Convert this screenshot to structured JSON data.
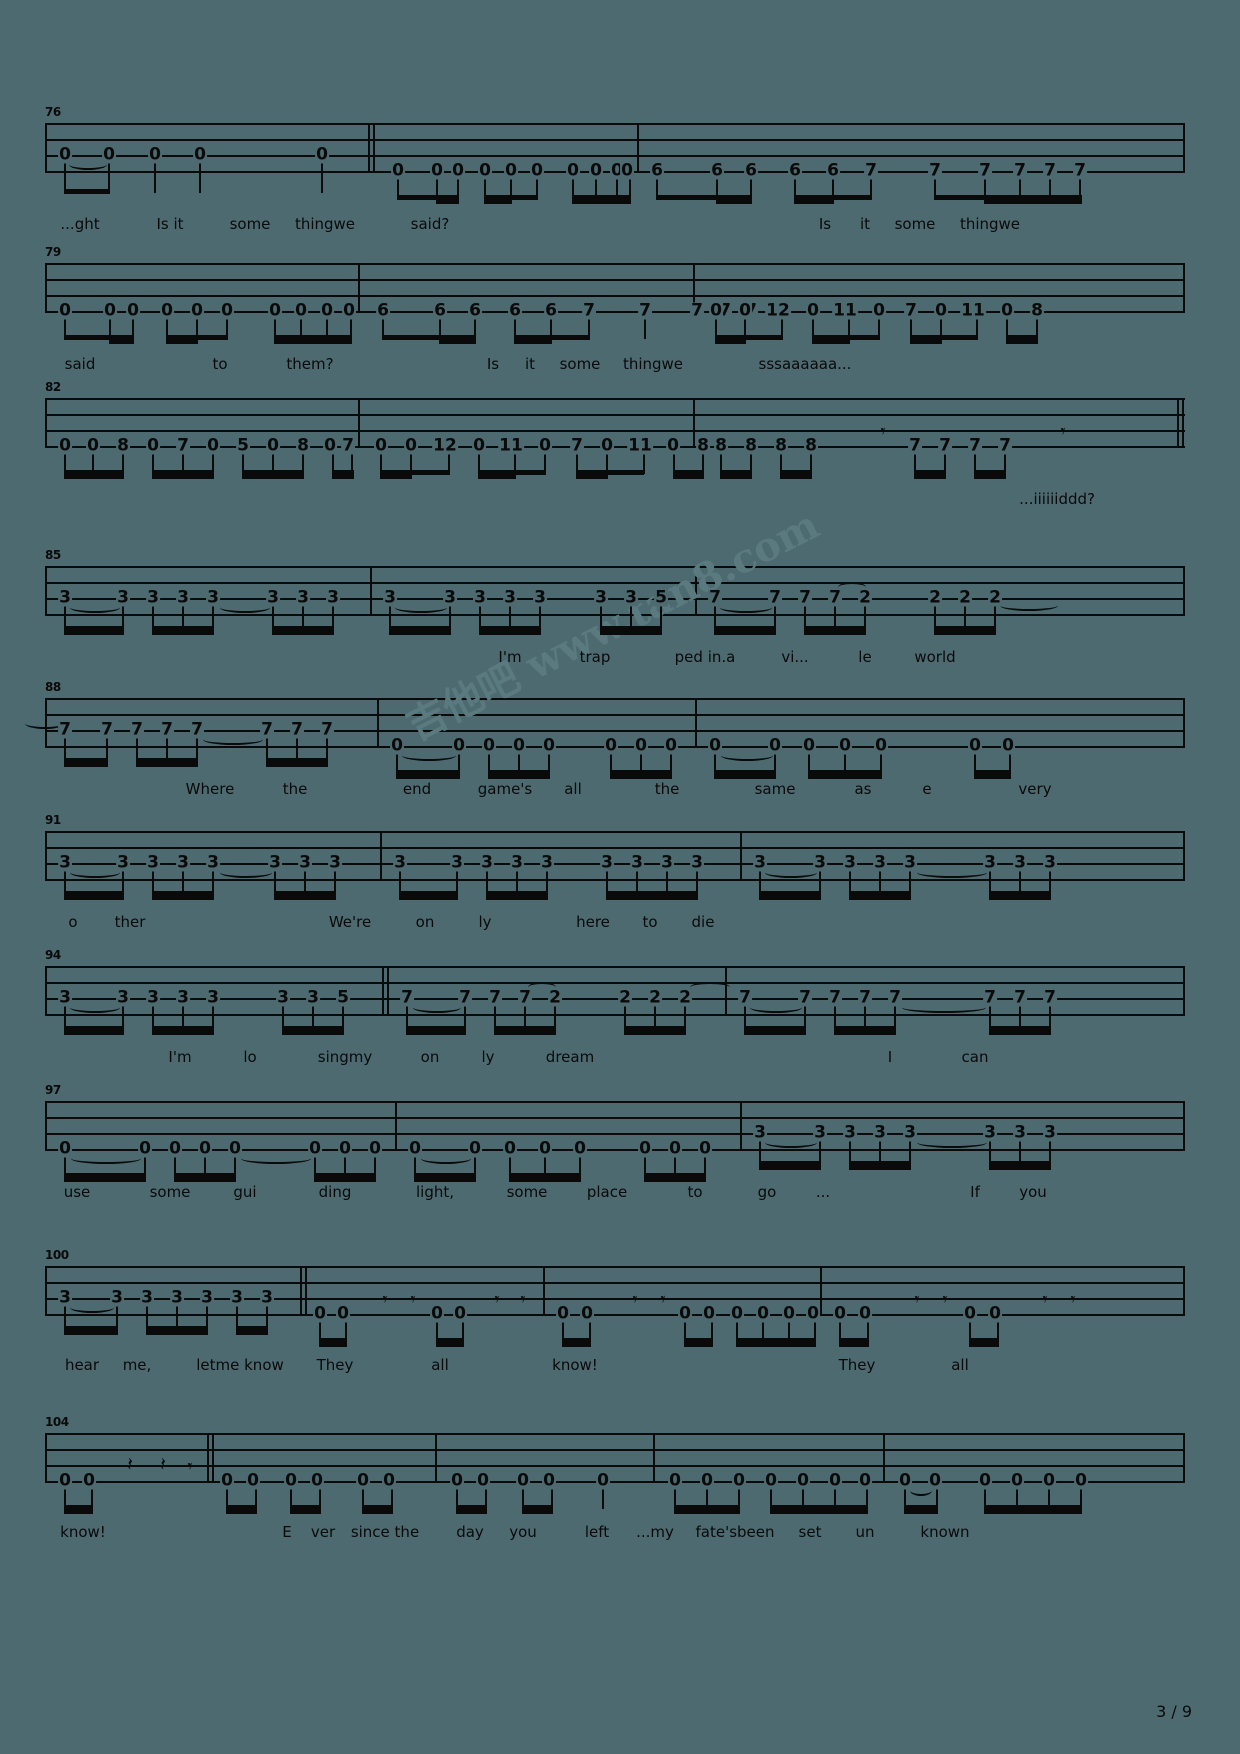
{
  "document": {
    "type": "guitar-bass-tablature",
    "page_label": "3 / 9",
    "watermark": "吉他吧 www.tan8.com",
    "staff_lines": 4,
    "background_color": "#4d6a70",
    "ink_color": "#0a0a0a"
  },
  "systems": [
    {
      "measure_number": "76",
      "notes": "0 0 0 0 0 | 0 0 0 0 0 0 0 0 0 0 | 6 6 6 6 6 7 7 7 7 7 7",
      "lyrics": [
        "...ght",
        "Is  it",
        "some",
        "thingwe",
        "said?",
        "Is",
        "it",
        "some",
        "thingwe"
      ]
    },
    {
      "measure_number": "79",
      "notes": "0 0 0 0 0 0 0 0 0 0 | 6 6 6 6 6 7 7 7 7 7 7 | 0 0 12 0 11 0 7 0 11 0 8",
      "lyrics": [
        "said",
        "to",
        "them?",
        "Is",
        "it",
        "some",
        "thingwe",
        "sssaaaaaa..."
      ]
    },
    {
      "measure_number": "82",
      "notes": "0 0 8 0 7 0 5 0 8 0 7 | 0 0 12 0 11 0 7 0 11 0 8 | 8 8 8 8 7 7 7 7",
      "lyrics": [
        "...iiiiiiddd?"
      ]
    },
    {
      "measure_number": "85",
      "notes": "3 3 3 3 3 3 3 3 | 3 3 3 3 3 3 5 | 7 7 7 7 2 2 2 2",
      "lyrics": [
        "I'm",
        "trap",
        "ped in.a",
        "vi...",
        "le",
        "world"
      ]
    },
    {
      "measure_number": "88",
      "notes": "7 7 7 7 7 7 7 7 | 0 0 0 0 0 0 0 0 | 0 0 0 0 0 0 0",
      "lyrics": [
        "Where",
        "the",
        "end",
        "game's",
        "all",
        "the",
        "same",
        "as",
        "e",
        "very"
      ]
    },
    {
      "measure_number": "91",
      "notes": "3 3 3 3 3 3 3 3 | 3 3 3 3 3 3 3 3 | 3 3 3 3 3 3 3",
      "lyrics": [
        "o",
        "ther",
        "We're",
        "on",
        "ly",
        "here",
        "to",
        "die"
      ]
    },
    {
      "measure_number": "94",
      "notes": "3 3 3 3 3 3 5 | 7 7 7 7 2 2 2 2 | 7 7 7 7 7 7 7 7",
      "lyrics": [
        "I'm",
        "lo",
        "singmy",
        "on",
        "ly",
        "dream",
        "I",
        "can"
      ]
    },
    {
      "measure_number": "97",
      "notes": "0 0 0 0 0 0 0 | 0 0 0 0 0 0 0 | 3 3 3 3 3 3 3 3",
      "lyrics": [
        "use",
        "some",
        "gui",
        "ding",
        "light,",
        "some",
        "place",
        "to",
        "go",
        "...",
        "If",
        "you"
      ]
    },
    {
      "measure_number": "100",
      "notes": "3 3 3 3 3 3 3 | 0 0 ( ) 0 0 ( ) | 0 0 ( ) 0 0 0 0 0 0 | 0 0 ( ) 0 0 ( )",
      "lyrics": [
        "hear",
        "me,",
        "letme know",
        "They",
        "all",
        "know!",
        "They",
        "all"
      ]
    },
    {
      "measure_number": "104",
      "notes": "0 0 rests | 0 0 0 0 0 0 | 0 0 0 0 0 | 0 0 0 0 0 0 0 | 0 0 0 0 0",
      "lyrics": [
        "know!",
        "E",
        "ver",
        "since the",
        "day",
        "you",
        "left",
        "...my",
        "fate'sbeen",
        "set",
        "un",
        "known"
      ]
    }
  ]
}
